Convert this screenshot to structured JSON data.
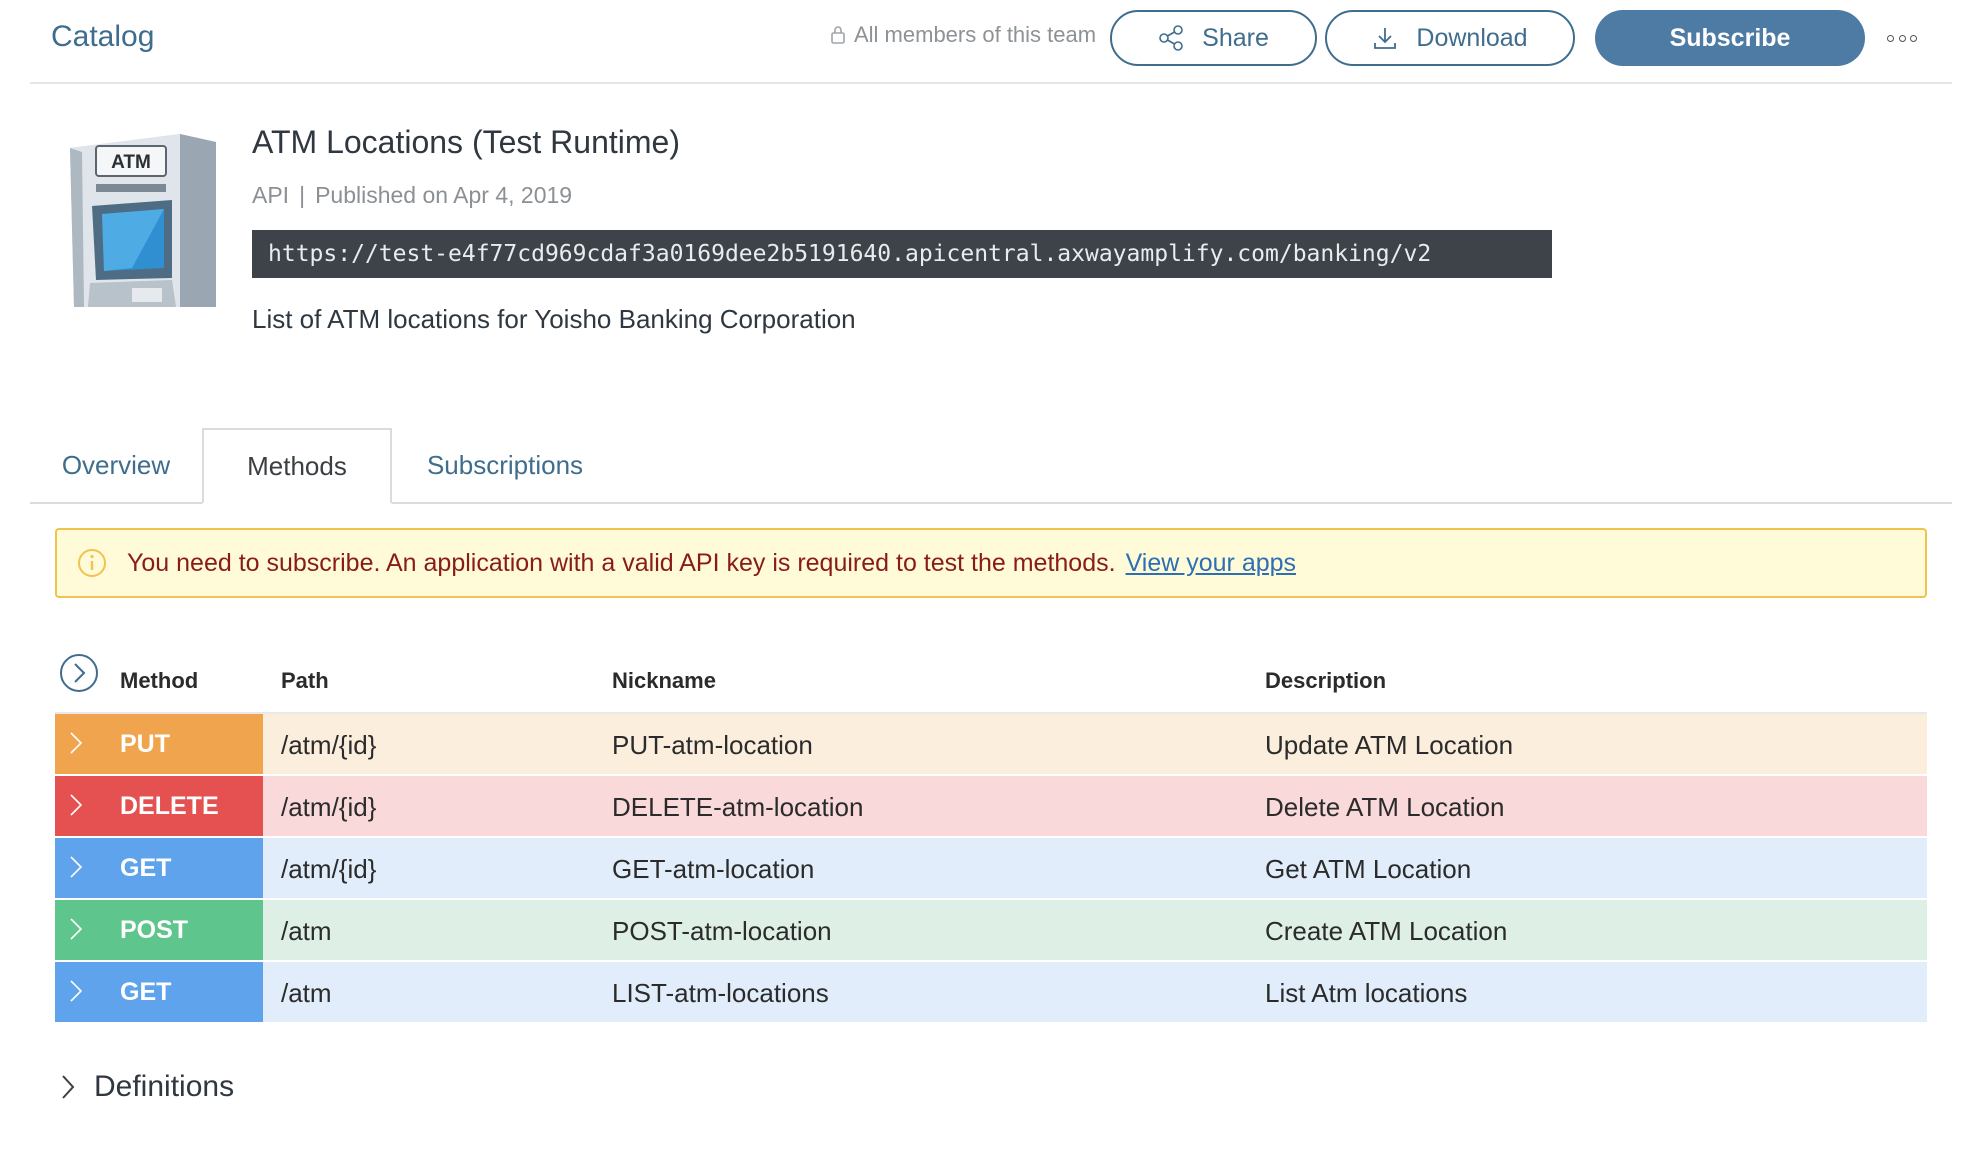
{
  "header": {
    "catalog_label": "Catalog",
    "visibility_text": "All members of this team",
    "share_label": "Share",
    "download_label": "Download",
    "subscribe_label": "Subscribe"
  },
  "api": {
    "title": "ATM Locations (Test Runtime)",
    "type": "API",
    "separator": "|",
    "published": "Published on Apr 4, 2019",
    "url": "https://test-e4f77cd969cdaf3a0169dee2b5191640.apicentral.axwayamplify.com/banking/v2",
    "description": "List of ATM locations for Yoisho Banking Corporation",
    "image_text": "ATM"
  },
  "tabs": [
    {
      "label": "Overview"
    },
    {
      "label": "Methods"
    },
    {
      "label": "Subscriptions"
    }
  ],
  "alert": {
    "message": "You need to subscribe. An application with a valid API key is required to test the methods.",
    "link_text": "View your apps"
  },
  "methods": {
    "columns": [
      "Method",
      "Path",
      "Nickname",
      "Description"
    ],
    "rows": [
      {
        "verb": "PUT",
        "path": "/atm/{id}",
        "nickname": "PUT-atm-location",
        "description": "Update ATM Location"
      },
      {
        "verb": "DELETE",
        "path": "/atm/{id}",
        "nickname": "DELETE-atm-location",
        "description": "Delete ATM Location"
      },
      {
        "verb": "GET",
        "path": "/atm/{id}",
        "nickname": "GET-atm-location",
        "description": "Get ATM Location"
      },
      {
        "verb": "POST",
        "path": "/atm",
        "nickname": "POST-atm-location",
        "description": "Create ATM Location"
      },
      {
        "verb": "GET",
        "path": "/atm",
        "nickname": "LIST-atm-locations",
        "description": "List Atm locations"
      }
    ]
  },
  "definitions_label": "Definitions",
  "colors": {
    "accent": "#3f6d8e",
    "subscribe": "#4d7ba3",
    "put": "#f0a44e",
    "delete": "#e55050",
    "get": "#5ea3ec",
    "post": "#5ec58c",
    "alert_bg": "#fffbd9",
    "alert_border": "#f0c34f"
  },
  "icons": [
    "lock-icon",
    "share-icon",
    "download-icon",
    "more-icon",
    "info-icon",
    "chevron-circle-icon",
    "chevron-right-icon"
  ]
}
